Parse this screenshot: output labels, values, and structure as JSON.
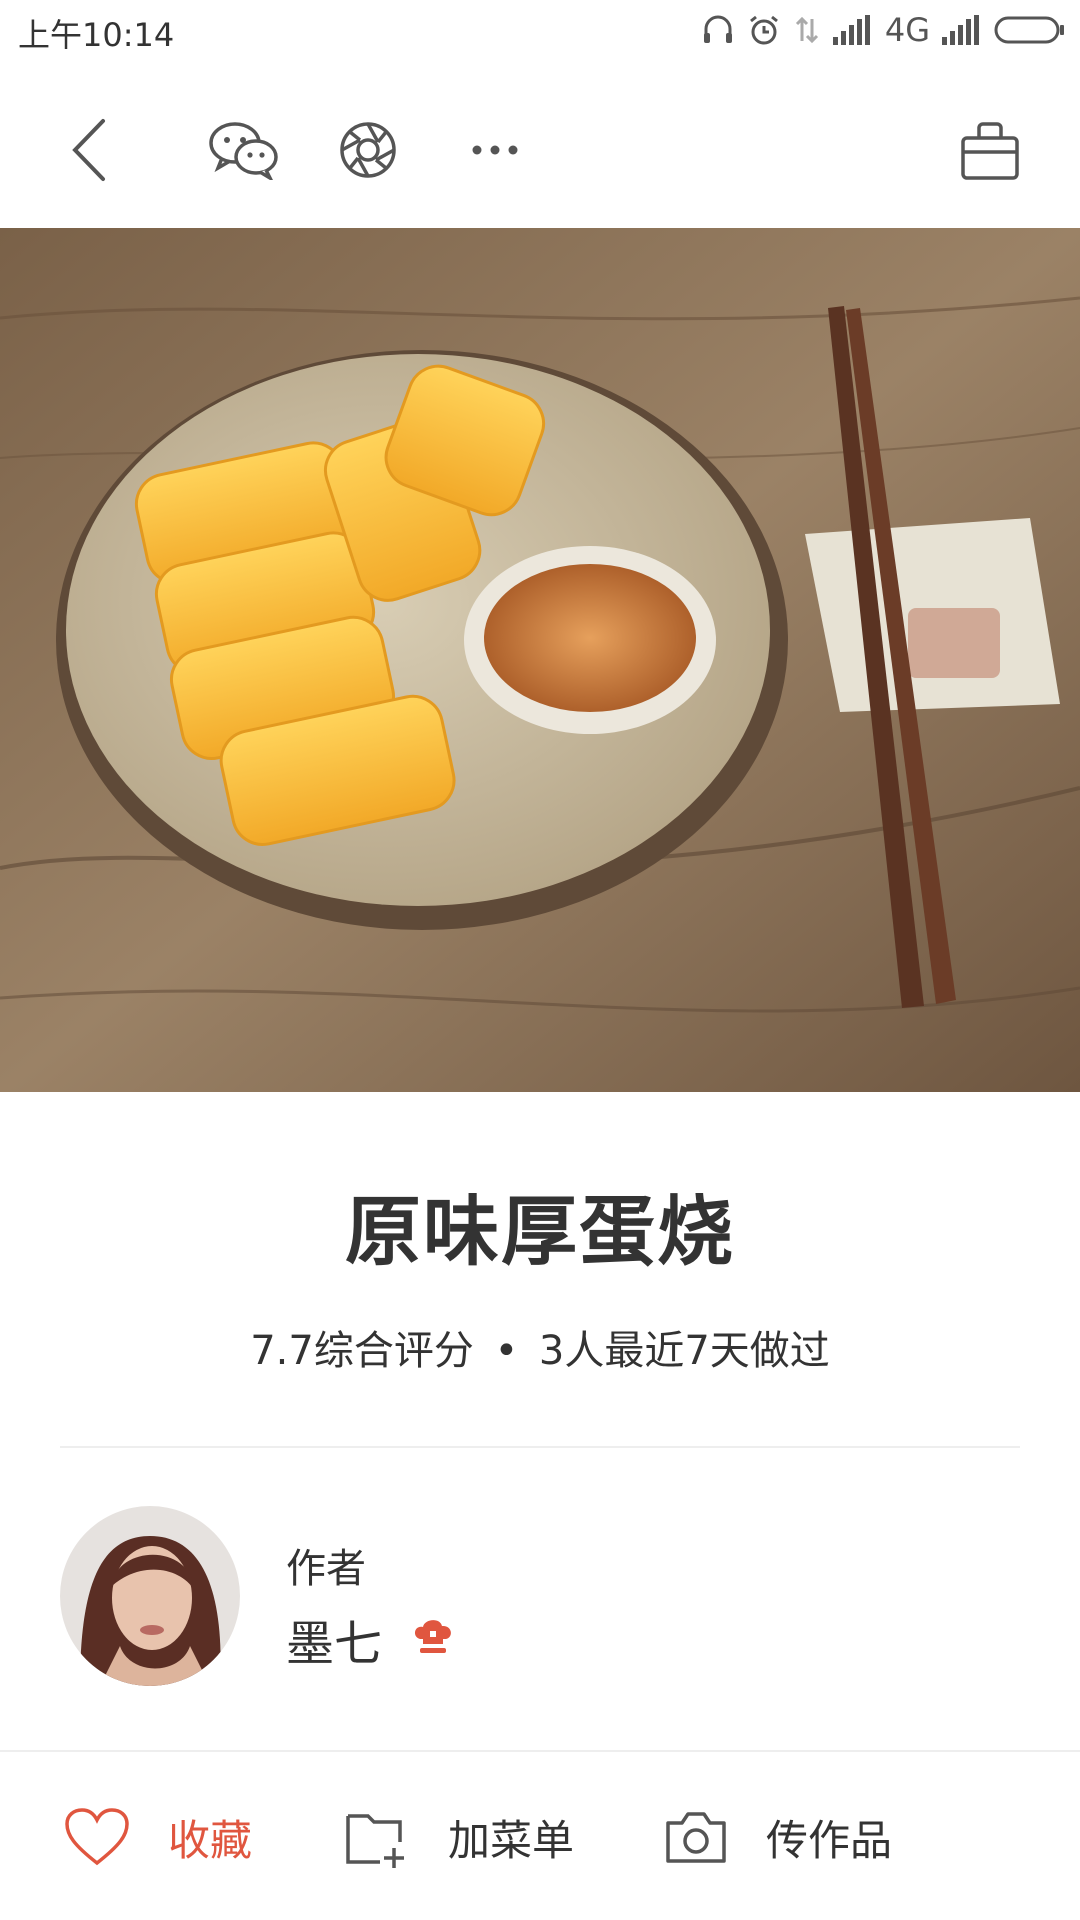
{
  "status_bar": {
    "time": "上午10:14",
    "network": "4G",
    "icons": [
      "headphones-icon",
      "alarm-icon",
      "data-transfer-icon",
      "signal-icon",
      "signal-icon-2",
      "battery-icon"
    ]
  },
  "nav": {
    "icons": [
      "back-icon",
      "wechat-icon",
      "moments-icon",
      "more-icon",
      "basket-icon"
    ]
  },
  "recipe": {
    "title": "原味厚蛋烧",
    "rating": "7.7综合评分",
    "separator": "•",
    "recent": "3人最近7天做过"
  },
  "author": {
    "label": "作者",
    "name": "墨七",
    "badge_icon": "chef-hat-icon"
  },
  "bottom_bar": {
    "favorite_label": "收藏",
    "add_menu_label": "加菜单",
    "upload_label": "传作品"
  },
  "colors": {
    "accent": "#e0563f",
    "text": "#333333",
    "divider": "#eeeeee"
  }
}
